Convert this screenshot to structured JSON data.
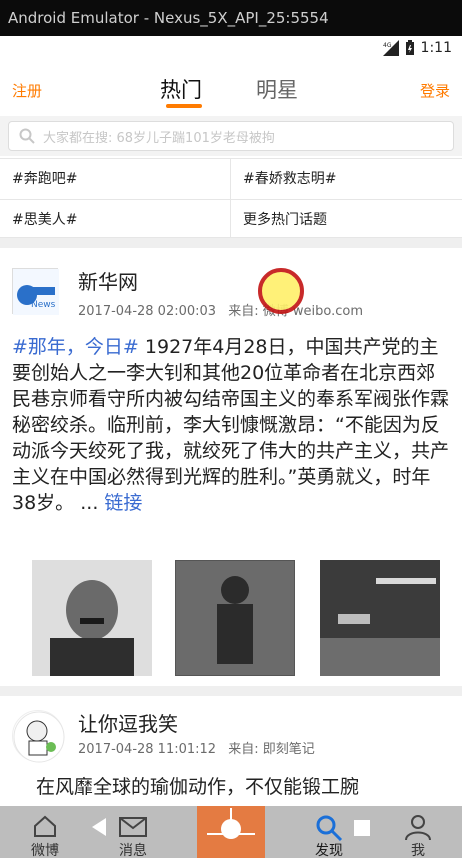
{
  "window": {
    "title": "Android Emulator - Nexus_5X_API_25:5554"
  },
  "statusbar": {
    "network": "4G",
    "time": "1:11"
  },
  "header": {
    "register": "注册",
    "tabs": [
      {
        "label": "热门"
      },
      {
        "label": "明星"
      }
    ],
    "login": "登录"
  },
  "search": {
    "placeholder": "大家都在搜: 68岁儿子踹101岁老母被拘"
  },
  "topics": [
    "#奔跑吧#",
    "#春娇救志明#",
    "#思美人#",
    "更多热门话题"
  ],
  "post1": {
    "author": "新华网",
    "time": "2017-04-28 02:00:03",
    "source": "来自: 微博 weibo.com",
    "hashtag": "#那年，今日#",
    "text": " 1927年4月28日，中国共产党的主要创始人之一李大钊和其他20位革命者在北京西郊民巷京师看守所内被勾结帝国主义的奉系军阀张作霖秘密绞杀。临刑前，李大钊慷慨激昂：“不能因为反动派今天绞死了我，就绞死了伟大的共产主义，共产主义在中国必然得到光辉的胜利。”英勇就义，时年38岁。",
    "ellipsis": "...",
    "link": "链接",
    "avatar_text": "新华网 News"
  },
  "post2": {
    "author": "让你逗我笑",
    "time": "2017-04-28 11:01:12",
    "source": "来自: 即刻笔记",
    "partial": "在风靡全球的瑜伽动作，不仅能锻工腕"
  },
  "bottom_nav": {
    "weibo": "微博",
    "messages": "消息",
    "discover": "发现",
    "me": "我"
  },
  "colors": {
    "accent": "#ff7b00",
    "link": "#3a6bd1"
  }
}
